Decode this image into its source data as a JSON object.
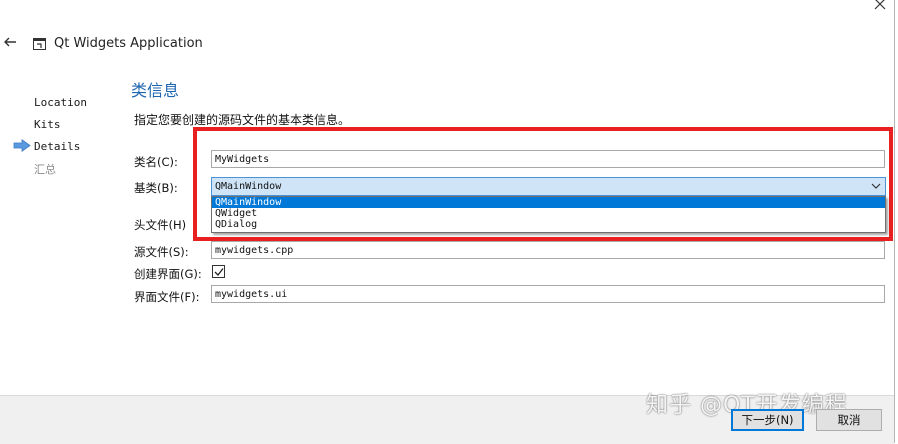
{
  "window": {
    "title": "Qt Widgets Application"
  },
  "steps": [
    {
      "label": "Location",
      "state": "done"
    },
    {
      "label": "Kits",
      "state": "done"
    },
    {
      "label": "Details",
      "state": "current"
    },
    {
      "label": "汇总",
      "state": "pending"
    }
  ],
  "page": {
    "title": "类信息",
    "description": "指定您要创建的源码文件的基本类信息。"
  },
  "form": {
    "class_name": {
      "label": "类名(C):",
      "value": "MyWidgets"
    },
    "base_class": {
      "label": "基类(B):",
      "value": "QMainWindow",
      "options": [
        "QMainWindow",
        "QWidget",
        "QDialog"
      ]
    },
    "header_file": {
      "label": "头文件(H)"
    },
    "source_file": {
      "label": "源文件(S):",
      "value": "mywidgets.cpp"
    },
    "create_form": {
      "label": "创建界面(G):",
      "checked": true
    },
    "form_file": {
      "label": "界面文件(F):",
      "value": "mywidgets.ui"
    }
  },
  "buttons": {
    "next": "下一步(N)",
    "cancel": "取消"
  },
  "watermark": "知乎 @QT开发编程",
  "colors": {
    "accent": "#1e66b0",
    "selection": "#0078d7",
    "annotation": "#e8201f"
  }
}
